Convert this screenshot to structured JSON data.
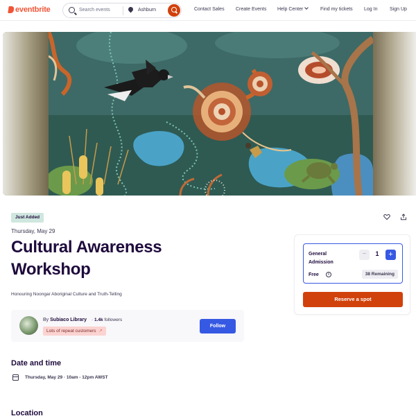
{
  "nav": {
    "logo": "eventbrite",
    "search_placeholder": "Search events",
    "location": "Ashburn",
    "links": {
      "contact_sales": "Contact Sales",
      "create_events": "Create Events",
      "help_center": "Help Center",
      "find_tickets": "Find my tickets",
      "login": "Log In",
      "signup": "Sign Up"
    }
  },
  "event": {
    "badge": "Just Added",
    "date_short": "Thursday, May 29",
    "title": "Cultural Awareness Workshop",
    "summary": "Honouring Noongar Aboriginal Culture and Truth-Telling"
  },
  "organizer": {
    "by_prefix": "By",
    "name": "Subiaco Library",
    "followers_count": "1.4k",
    "followers_label": "followers",
    "repeat_badge": "Lots of repeat customers",
    "follow_label": "Follow"
  },
  "date_time": {
    "heading": "Date and time",
    "value": "Thursday, May 29 · 10am - 12pm AWST"
  },
  "location": {
    "heading": "Location"
  },
  "ticket": {
    "name": "General Admission",
    "quantity": "1",
    "minus": "−",
    "plus": "+",
    "price": "Free",
    "remaining": "38 Remaining",
    "reserve_label": "Reserve a spot"
  },
  "colors": {
    "brand": "#f05537",
    "primary_blue": "#3659e3",
    "reserve_orange": "#d1410c",
    "badge_green": "#cfe7df",
    "text_dark": "#1e0a3c"
  }
}
